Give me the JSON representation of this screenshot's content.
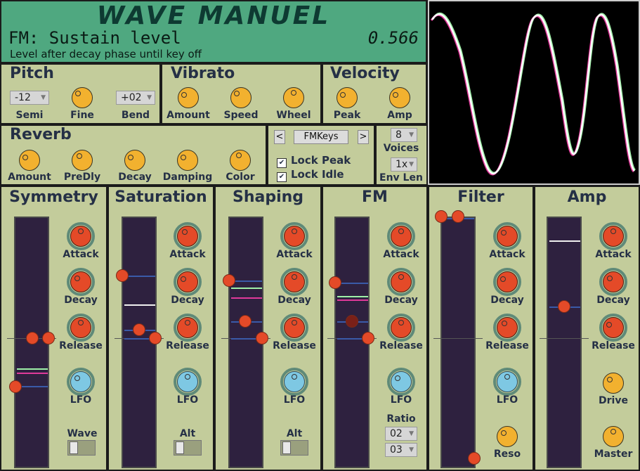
{
  "header": {
    "logo": "WAVE MANUEL",
    "param_name": "FM: Sustain level",
    "param_value": "0.566",
    "param_desc": "Level after decay phase until key off"
  },
  "pitch": {
    "title": "Pitch",
    "semi_value": "-12",
    "semi_label": "Semi",
    "fine_label": "Fine",
    "bend_value": "+02",
    "bend_label": "Bend"
  },
  "vibrato": {
    "title": "Vibrato",
    "amount_label": "Amount",
    "speed_label": "Speed",
    "wheel_label": "Wheel"
  },
  "velocity": {
    "title": "Velocity",
    "peak_label": "Peak",
    "amp_label": "Amp"
  },
  "reverb": {
    "title": "Reverb",
    "amount_label": "Amount",
    "predly_label": "PreDly",
    "decay_label": "Decay",
    "damping_label": "Damping",
    "color_label": "Color"
  },
  "preset": {
    "prev": "<",
    "name": "FMKeys",
    "next": ">",
    "lock_peak": "Lock Peak",
    "lock_idle": "Lock Idle"
  },
  "voices": {
    "value": "8",
    "label": "Voices",
    "envlen_value": "1x",
    "envlen_label": "Env Len"
  },
  "symmetry": {
    "title": "Symmetry",
    "attack": "Attack",
    "decay": "Decay",
    "release": "Release",
    "lfo": "LFO",
    "wave": "Wave"
  },
  "saturation": {
    "title": "Saturation",
    "attack": "Attack",
    "decay": "Decay",
    "release": "Release",
    "lfo": "LFO",
    "alt": "Alt"
  },
  "shaping": {
    "title": "Shaping",
    "attack": "Attack",
    "decay": "Decay",
    "release": "Release",
    "lfo": "LFO",
    "alt": "Alt"
  },
  "fm": {
    "title": "FM",
    "attack": "Attack",
    "decay": "Decay",
    "release": "Release",
    "lfo": "LFO",
    "ratio_label": "Ratio",
    "ratio1": "02",
    "ratio2": "03"
  },
  "filter": {
    "title": "Filter",
    "attack": "Attack",
    "decay": "Decay",
    "release": "Release",
    "lfo": "LFO",
    "reso": "Reso"
  },
  "amp": {
    "title": "Amp",
    "attack": "Attack",
    "decay": "Decay",
    "release": "Release",
    "drive": "Drive",
    "master": "Master"
  },
  "colors": {
    "panel": "#c3cc9b",
    "header": "#4fa880",
    "slot": "#2e213f",
    "knob_orange": "#e44a28",
    "knob_yellow": "#f2b12f",
    "knob_blue": "#7ec8e3"
  }
}
